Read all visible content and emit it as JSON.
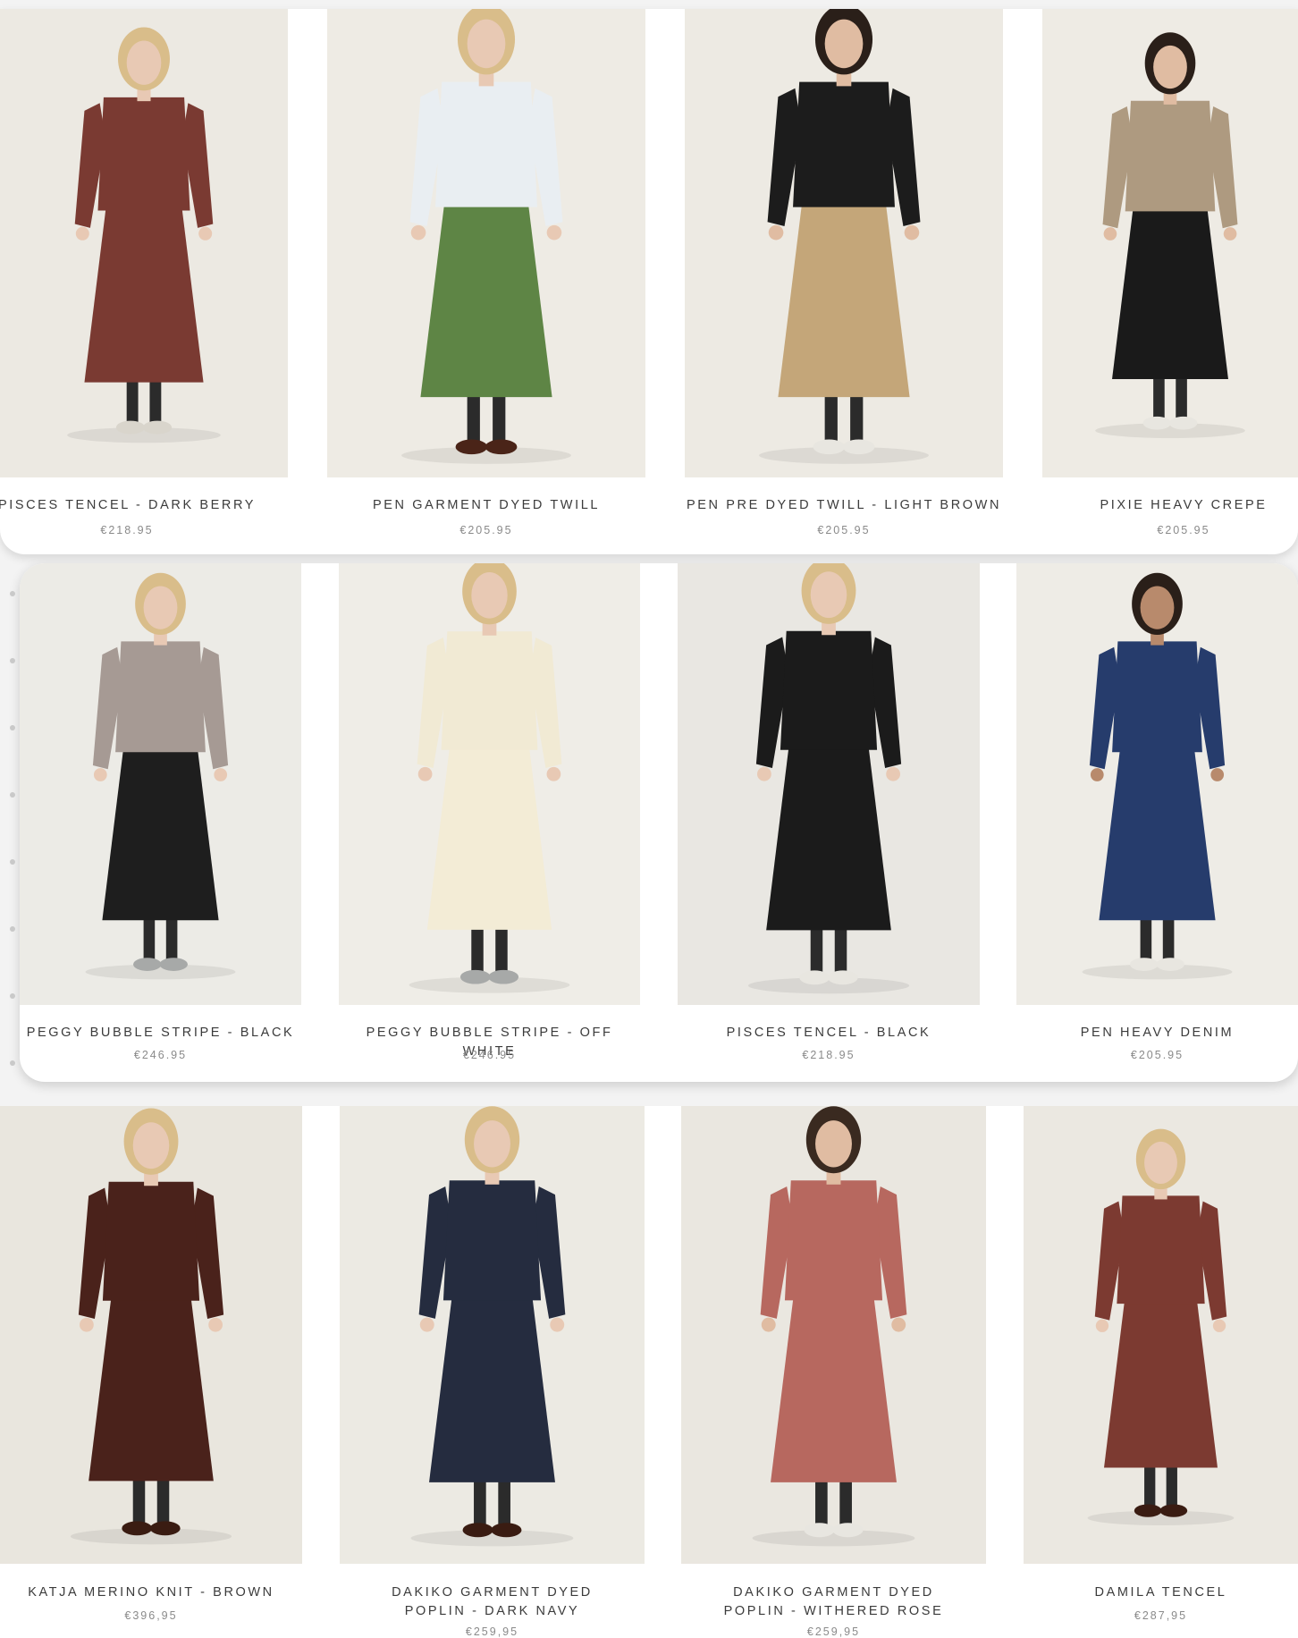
{
  "rows": [
    {
      "products": [
        {
          "name": "PISCES TENCEL - DARK BERRY",
          "price": "€218.95",
          "top": "#7a3a32",
          "bottom": "#7a3a32",
          "shoes": "#d9d5cc",
          "bg": "#ece9e2",
          "hair": "#d9bd8a",
          "skin": "#e8c9b4"
        },
        {
          "name": "PEN GARMENT DYED TWILL",
          "price": "€205.95",
          "top": "#e9eef2",
          "bottom": "#5e8545",
          "shoes": "#4a2418",
          "bg": "#eeebe4",
          "hair": "#d9bd8a",
          "skin": "#e8c9b4"
        },
        {
          "name": "PEN PRE DYED TWILL - LIGHT BROWN",
          "price": "€205.95",
          "top": "#1c1c1c",
          "bottom": "#c4a679",
          "shoes": "#e8e6e0",
          "bg": "#edeae3",
          "hair": "#2a1f19",
          "skin": "#e0bca2"
        },
        {
          "name": "PIXIE HEAVY CREPE",
          "price": "€205.95",
          "top": "#ae9a80",
          "bottom": "#1a1a1a",
          "shoes": "#e8e6e0",
          "bg": "#eeebe4",
          "hair": "#2a1f19",
          "skin": "#e0bca2"
        }
      ]
    },
    {
      "products": [
        {
          "name": "PEGGY BUBBLE STRIPE - BLACK",
          "price": "€246.95",
          "top": "#a69a94",
          "bottom": "#1e1e1e",
          "shoes": "#a7a9a8",
          "bg": "#ecebe6",
          "hair": "#d9bd8a",
          "skin": "#e8c9b4"
        },
        {
          "name": "PEGGY BUBBLE STRIPE - OFF WHITE",
          "price": "€246.95",
          "top": "#f1ead4",
          "bottom": "#f3ecd6",
          "shoes": "#a7a9a8",
          "bg": "#efede7",
          "hair": "#d9bd8a",
          "skin": "#e8c9b4"
        },
        {
          "name": "PISCES TENCEL - BLACK",
          "price": "€218.95",
          "top": "#1b1b1b",
          "bottom": "#1b1b1b",
          "shoes": "#e8e6e0",
          "bg": "#e9e7e2",
          "hair": "#d9bd8a",
          "skin": "#e8c9b4"
        },
        {
          "name": "PEN HEAVY DENIM",
          "price": "€205.95",
          "top": "#263c6c",
          "bottom": "#263c6c",
          "shoes": "#e8e6e0",
          "bg": "#eeece6",
          "hair": "#2a1f19",
          "skin": "#b88a6c"
        }
      ]
    },
    {
      "products": [
        {
          "name": "KATJA MERINO KNIT - BROWN",
          "price": "€396,95",
          "top": "#4a221b",
          "bottom": "#4a221b",
          "shoes": "#3a1c12",
          "bg": "#e9e6de",
          "hair": "#d9bd8a",
          "skin": "#e8c9b4"
        },
        {
          "name": "DAKIKO GARMENT DYED POPLIN - DARK NAVY",
          "price": "€259,95",
          "top": "#252c3f",
          "bottom": "#252c3f",
          "shoes": "#3a1c12",
          "bg": "#eceae3",
          "hair": "#d9bd8a",
          "skin": "#e8c9b4"
        },
        {
          "name": "DAKIKO GARMENT DYED POPLIN - WITHERED ROSE",
          "price": "€259,95",
          "top": "#b7685f",
          "bottom": "#b7685f",
          "shoes": "#e8e6e0",
          "bg": "#eae7e0",
          "hair": "#3a2a20",
          "skin": "#e0bca2"
        },
        {
          "name": "DAMILA TENCEL",
          "price": "€287,95",
          "top": "#7c3a31",
          "bottom": "#7c3a31",
          "shoes": "#3a1c12",
          "bg": "#ebe8e1",
          "hair": "#d9bd8a",
          "skin": "#e8c9b4"
        }
      ]
    }
  ]
}
